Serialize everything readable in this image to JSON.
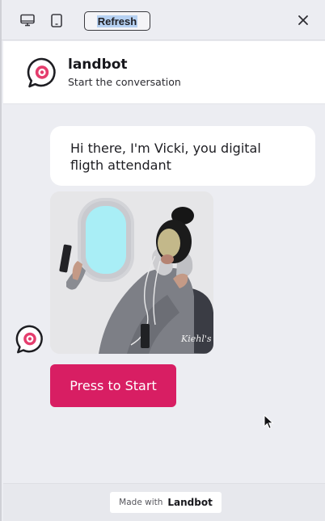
{
  "toolbar": {
    "desktop_icon": "desktop-icon",
    "tablet_icon": "tablet-icon",
    "refresh_label": "Refresh",
    "close_icon": "close-icon"
  },
  "header": {
    "logo_icon": "landbot-logo-icon",
    "title": "landbot",
    "subtitle": "Start the conversation"
  },
  "chat": {
    "bot_message": "Hi there, I'm Vicki, you digital fligth attendant",
    "media": {
      "description_icon": "image-woman-airplane-selfie",
      "watermark": "Kiehl's"
    },
    "bot_avatar_icon": "landbot-avatar-icon",
    "start_button_label": "Press to Start"
  },
  "footer": {
    "made_with_label": "Made with",
    "brand_label": "Landbot"
  },
  "colors": {
    "accent": "#d81e63",
    "logo_pink": "#e43d6d",
    "logo_dark": "#1d1d22",
    "background": "#ecedf2"
  }
}
